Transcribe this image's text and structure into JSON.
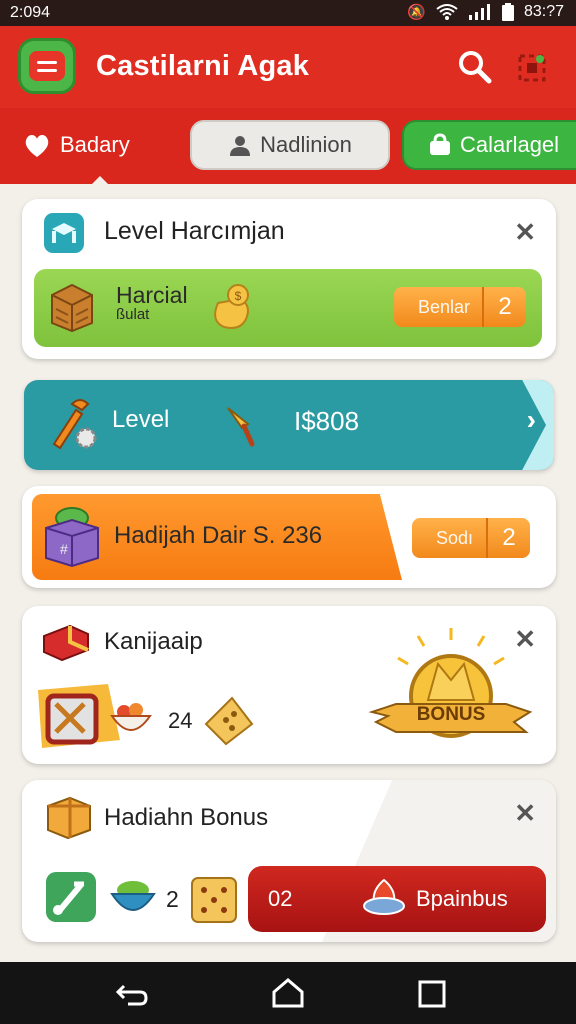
{
  "status_bar": {
    "time": "2:094",
    "clock_right": "83:?7",
    "icons": [
      "mute-icon",
      "wifi-icon",
      "signal-icon",
      "battery-icon"
    ]
  },
  "app_bar": {
    "title": "Castilarni  Agak",
    "icons": [
      "menu-icon",
      "search-icon",
      "grid-icon"
    ]
  },
  "tabs": [
    {
      "label": "Badary",
      "icon": "heart-icon"
    },
    {
      "label": "Nadlinion",
      "icon": "person-icon"
    },
    {
      "label": "Calarlagel",
      "icon": "bag-icon"
    }
  ],
  "cards": {
    "level_card": {
      "title": "Level Harcımjan",
      "strip_title": "Harcial",
      "strip_sub": "ßulat",
      "button_label": "Benlar",
      "button_count": "2"
    },
    "level_banner": {
      "label": "Level",
      "amount": "I$808"
    },
    "orange_card": {
      "text": "Hadijah Dair S. 236",
      "button_label": "Sodı",
      "button_count": "2"
    },
    "bonus_card": {
      "title": "Kanijaaip",
      "count": "24",
      "badge": "BONUS"
    },
    "hadiahn_card": {
      "title": "Hadiahn Bonus",
      "count": "2",
      "button_number": "02",
      "button_label": "Bpainbus"
    }
  },
  "colors": {
    "red": "#e02d22",
    "green": "#4cb648",
    "teal": "#2a9aa3",
    "orange": "#f67b12"
  }
}
